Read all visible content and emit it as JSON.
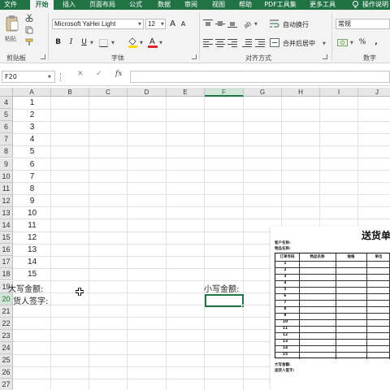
{
  "ribbon_tabs": [
    "文件",
    "开始",
    "插入",
    "页面布局",
    "公式",
    "数据",
    "审阅",
    "视图",
    "帮助",
    "PDF工具集",
    "更多工具",
    "操作说明"
  ],
  "active_tab": "开始",
  "ribbon": {
    "paste_label": "粘贴",
    "font_name": "Microsoft YaHei Light",
    "font_size": "12",
    "grow_font": "A",
    "shrink_font": "A",
    "bold": "B",
    "italic": "I",
    "underline": "U",
    "wrap_text": "自动换行",
    "merge_center": "合并后居中",
    "number_format": "常规",
    "percent": "%",
    "comma": ",",
    "group_clipboard": "剪贴板",
    "group_font": "字体",
    "group_alignment": "对齐方式",
    "group_number": "数字"
  },
  "formula_bar": {
    "name_box": "F20",
    "cancel": "✕",
    "enter": "✓",
    "function": "fx",
    "formula": ""
  },
  "sheet": {
    "columns": [
      "A",
      "B",
      "C",
      "D",
      "E",
      "F",
      "G",
      "H",
      "I",
      "J"
    ],
    "selected_column": "F",
    "rows": [
      "4",
      "5",
      "6",
      "7",
      "8",
      "9",
      "10",
      "11",
      "12",
      "13",
      "14",
      "15",
      "16",
      "17",
      "18",
      "19",
      "20",
      "21",
      "22",
      "23",
      "24",
      "25",
      "26",
      "27"
    ],
    "selected_row": "20",
    "a_values": [
      "1",
      "2",
      "3",
      "4",
      "5",
      "6",
      "7",
      "8",
      "9",
      "10",
      "11",
      "12",
      "13",
      "14",
      "15"
    ],
    "a19": "大写金额:",
    "a20": "货人签字:",
    "f19": "小写金额:"
  },
  "delivery_note": {
    "title": "送货单",
    "customer_label": "客户名称:",
    "item_label": "物品名称:",
    "headers": [
      "订单号码",
      "物品名称",
      "规格",
      "单位"
    ],
    "rows": [
      "1",
      "2",
      "3",
      "4",
      "5",
      "6",
      "7",
      "8",
      "9",
      "10",
      "11",
      "12",
      "13",
      "14",
      "15"
    ],
    "footer_amount": "大写金额:",
    "footer_sign": "送货人签字:"
  }
}
